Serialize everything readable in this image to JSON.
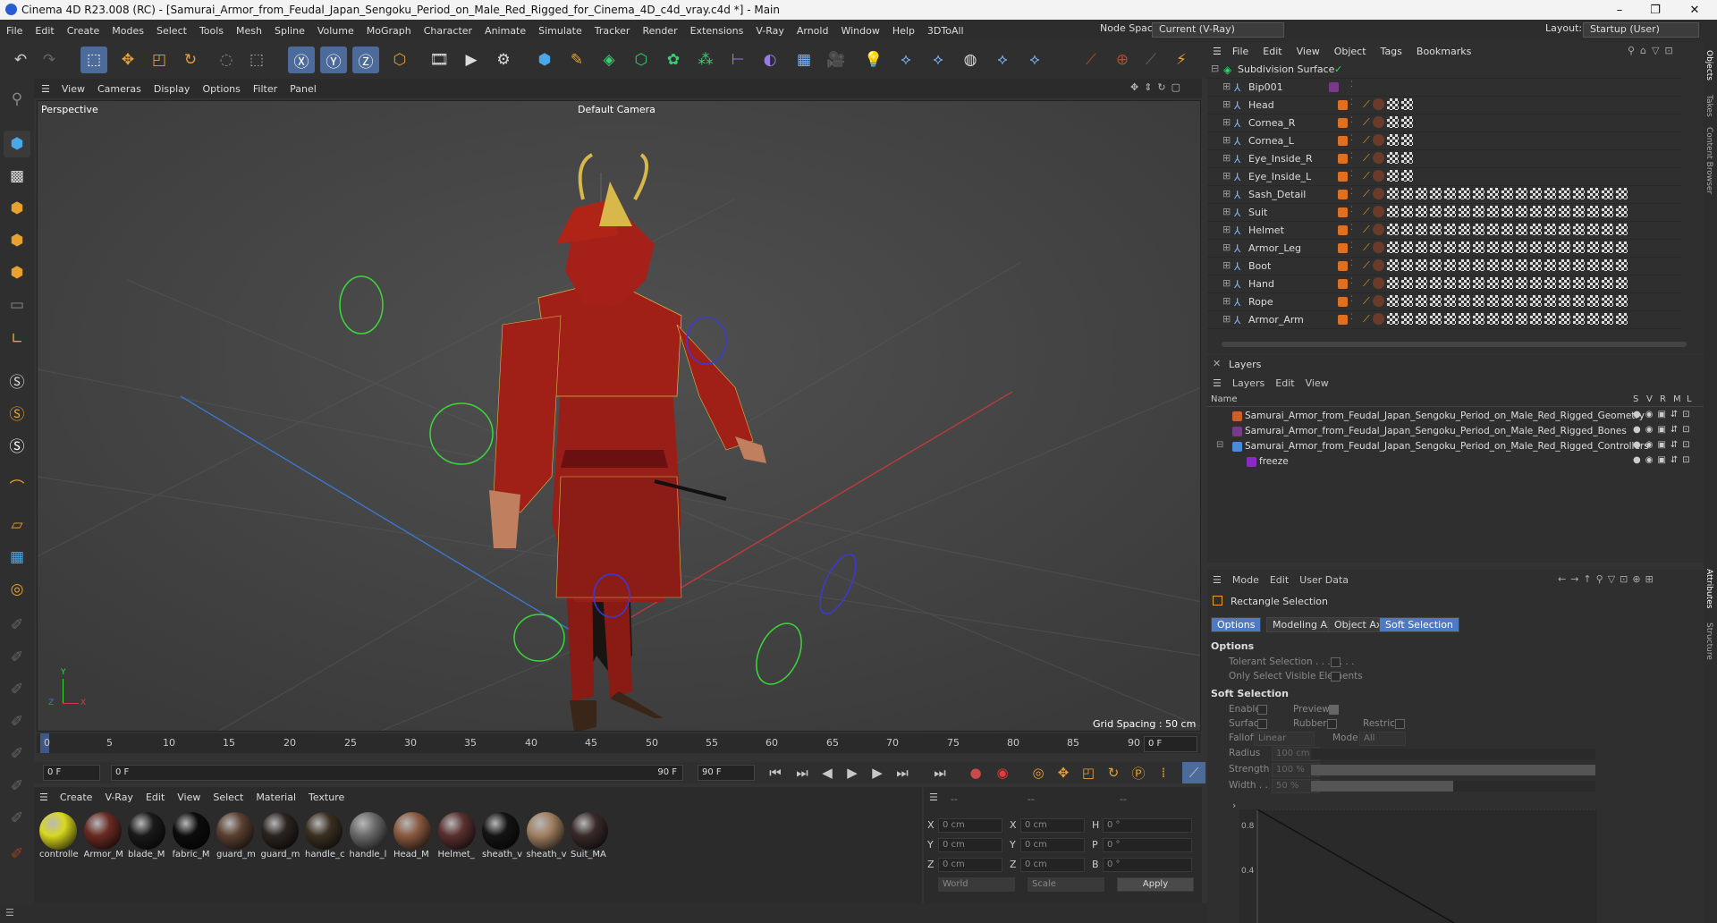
{
  "window": {
    "title": "Cinema 4D R23.008 (RC) - [Samurai_Armor_from_Feudal_Japan_Sengoku_Period_on_Male_Red_Rigged_for_Cinema_4D_c4d_vray.c4d *] - Main",
    "minimize": "–",
    "maximize": "❐",
    "close": "✕"
  },
  "menubar": {
    "items": [
      "File",
      "Edit",
      "Create",
      "Modes",
      "Select",
      "Tools",
      "Mesh",
      "Spline",
      "Volume",
      "MoGraph",
      "Character",
      "Animate",
      "Simulate",
      "Tracker",
      "Render",
      "Extensions",
      "V-Ray",
      "Arnold",
      "Window",
      "Help",
      "3DToAll"
    ],
    "node_space_label": "Node Space:",
    "node_space_value": "Current (V-Ray)",
    "layout_label": "Layout:",
    "layout_value": "Startup (User)"
  },
  "viewport": {
    "menu": [
      "View",
      "Cameras",
      "Display",
      "Options",
      "Filter",
      "Panel"
    ],
    "label": "Perspective",
    "camera": "Default Camera",
    "grid_spacing": "Grid Spacing : 50 cm",
    "axis_x": "X",
    "axis_y": "Y",
    "axis_z": "Z"
  },
  "timeline": {
    "ticks": [
      "0",
      "5",
      "10",
      "15",
      "20",
      "25",
      "30",
      "35",
      "40",
      "45",
      "50",
      "55",
      "60",
      "65",
      "70",
      "75",
      "80",
      "85",
      "90"
    ],
    "current_frame": "0 F"
  },
  "transport": {
    "start": "0 F",
    "range_start": "0 F",
    "range_end": "90 F",
    "end": "90 F"
  },
  "materials": {
    "menu": [
      "Create",
      "V-Ray",
      "Edit",
      "View",
      "Select",
      "Material",
      "Texture"
    ],
    "items": [
      {
        "label": "controlle",
        "color": "#d8d820"
      },
      {
        "label": "Armor_M",
        "color": "#6a2a22"
      },
      {
        "label": "blade_M",
        "color": "#1a1a1a"
      },
      {
        "label": "fabric_M",
        "color": "#0c0c0c"
      },
      {
        "label": "guard_m",
        "color": "#5a4030"
      },
      {
        "label": "guard_m",
        "color": "#2a2420"
      },
      {
        "label": "handle_c",
        "color": "#3a3022"
      },
      {
        "label": "handle_l",
        "color": "#6a6a6a"
      },
      {
        "label": "Head_M",
        "color": "#8a5a40"
      },
      {
        "label": "Helmet_",
        "color": "#5a3030"
      },
      {
        "label": "sheath_v",
        "color": "#141414"
      },
      {
        "label": "sheath_v",
        "color": "#a08060"
      },
      {
        "label": "Suit_MA",
        "color": "#3a2a2a"
      }
    ]
  },
  "coordinates": {
    "dash1": "--",
    "dash2": "--",
    "dash3": "--",
    "x_pos": "0 cm",
    "y_pos": "0 cm",
    "z_pos": "0 cm",
    "x_size": "0 cm",
    "y_size": "0 cm",
    "z_size": "0 cm",
    "h": "0 °",
    "p": "0 °",
    "b": "0 °",
    "lx": "X",
    "ly": "Y",
    "lz": "Z",
    "lx2": "X",
    "ly2": "Y",
    "lz2": "Z",
    "lh": "H",
    "lp": "P",
    "lb": "B",
    "world": "World",
    "scale": "Scale",
    "apply": "Apply"
  },
  "objects": {
    "menu": [
      "File",
      "Edit",
      "View",
      "Object",
      "Tags",
      "Bookmarks"
    ],
    "root": "Subdivision Surface",
    "items": [
      "Bip001",
      "Head",
      "Cornea_R",
      "Cornea_L",
      "Eye_Inside_R",
      "Eye_Inside_L",
      "Sash_Detail",
      "Suit",
      "Helmet",
      "Armor_Leg",
      "Boot",
      "Hand",
      "Rope",
      "Armor_Arm"
    ]
  },
  "layers": {
    "title": "Layers",
    "menu": [
      "Layers",
      "Edit",
      "View"
    ],
    "col_name": "Name",
    "cols": [
      "S",
      "V",
      "R",
      "M",
      "L"
    ],
    "items": [
      {
        "name": "Samurai_Armor_from_Feudal_Japan_Sengoku_Period_on_Male_Red_Rigged_Geometry",
        "color": "#c8602a"
      },
      {
        "name": "Samurai_Armor_from_Feudal_Japan_Sengoku_Period_on_Male_Red_Rigged_Bones",
        "color": "#7a3a8a"
      },
      {
        "name": "Samurai_Armor_from_Feudal_Japan_Sengoku_Period_on_Male_Red_Rigged_Controllers",
        "color": "#4a8ad8"
      },
      {
        "name": "freeze",
        "color": "#8a2ac8"
      }
    ]
  },
  "attributes": {
    "menu": [
      "Mode",
      "Edit",
      "User Data"
    ],
    "tool": "Rectangle Selection",
    "tabs": [
      "Options",
      "Modeling Axis",
      "Object Axis",
      "Soft Selection"
    ],
    "options_title": "Options",
    "tolerant": "Tolerant Selection . . . . . . .",
    "only_visible": "Only Select Visible Elements",
    "soft_title": "Soft Selection",
    "enable": "Enable",
    "preview": "Preview",
    "surface": "Surface",
    "rubber": "Rubber",
    "restrict": "Restrict",
    "falloff": "Falloff",
    "falloff_val": "Linear",
    "mode": "Mode",
    "mode_val": "All",
    "radius": "Radius",
    "radius_val": "100 cm",
    "strength": "Strength",
    "strength_val": "100 %",
    "width": "Width . .",
    "width_val": "50 %",
    "graph_08": "0.8",
    "graph_04": "0.4"
  },
  "sidetabs": [
    "Objects",
    "Takes",
    "Content Browser",
    "Attributes",
    "Structure"
  ]
}
